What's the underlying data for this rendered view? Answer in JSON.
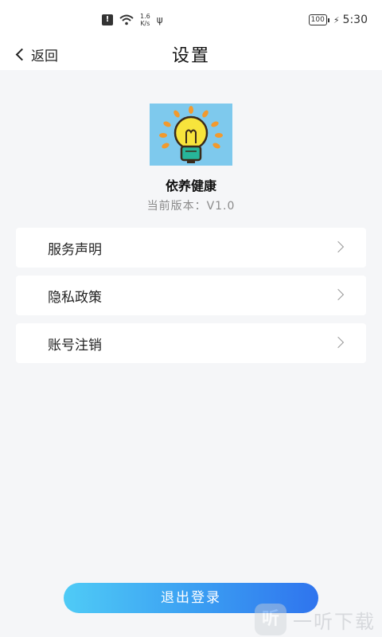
{
  "status_bar": {
    "net_speed_value": "1.6",
    "net_speed_unit": "K/s",
    "battery": "100",
    "time": "5:30"
  },
  "nav": {
    "back_label": "返回",
    "title": "设置"
  },
  "app": {
    "name": "依养健康",
    "version": "当前版本：V1.0"
  },
  "menu": {
    "items": [
      {
        "label": "服务声明"
      },
      {
        "label": "隐私政策"
      },
      {
        "label": "账号注销"
      }
    ]
  },
  "logout_label": "退出登录",
  "watermark": {
    "mark": "听",
    "text": "一听下载"
  },
  "colors": {
    "background": "#f5f6f8",
    "logo_bg": "#7ec9ed",
    "bulb": "#f7e43c",
    "logout_gradient_start": "#4fcbf6",
    "logout_gradient_end": "#2f74ee"
  }
}
